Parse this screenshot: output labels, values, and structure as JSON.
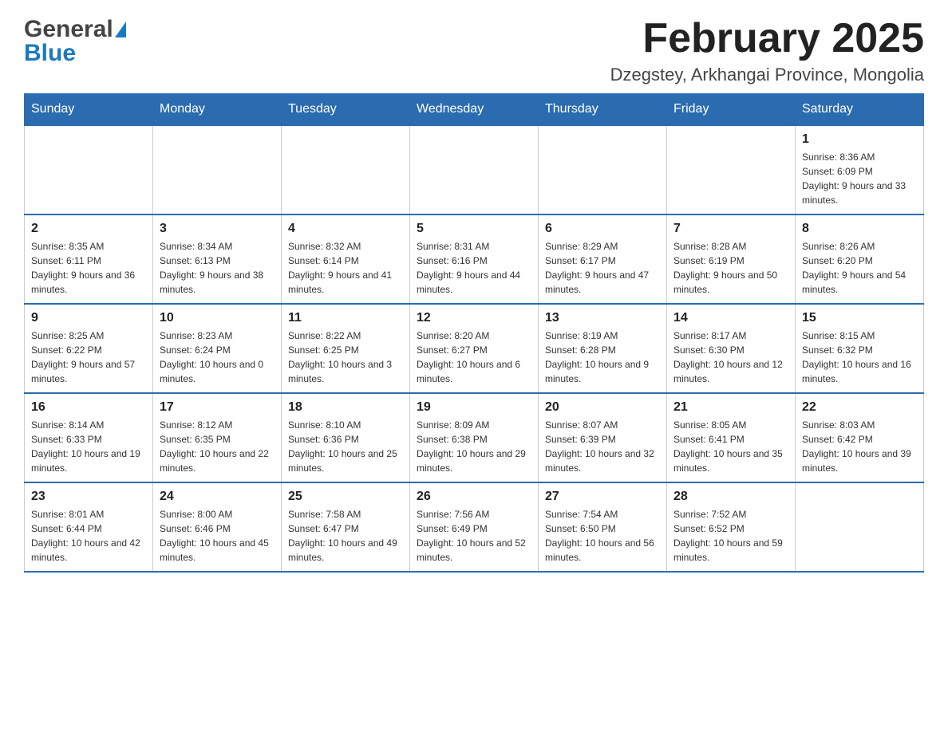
{
  "header": {
    "logo_general": "General",
    "logo_blue": "Blue",
    "month_title": "February 2025",
    "location": "Dzegstey, Arkhangai Province, Mongolia"
  },
  "days_of_week": [
    "Sunday",
    "Monday",
    "Tuesday",
    "Wednesday",
    "Thursday",
    "Friday",
    "Saturday"
  ],
  "weeks": [
    [
      {
        "day": "",
        "info": ""
      },
      {
        "day": "",
        "info": ""
      },
      {
        "day": "",
        "info": ""
      },
      {
        "day": "",
        "info": ""
      },
      {
        "day": "",
        "info": ""
      },
      {
        "day": "",
        "info": ""
      },
      {
        "day": "1",
        "info": "Sunrise: 8:36 AM\nSunset: 6:09 PM\nDaylight: 9 hours and 33 minutes."
      }
    ],
    [
      {
        "day": "2",
        "info": "Sunrise: 8:35 AM\nSunset: 6:11 PM\nDaylight: 9 hours and 36 minutes."
      },
      {
        "day": "3",
        "info": "Sunrise: 8:34 AM\nSunset: 6:13 PM\nDaylight: 9 hours and 38 minutes."
      },
      {
        "day": "4",
        "info": "Sunrise: 8:32 AM\nSunset: 6:14 PM\nDaylight: 9 hours and 41 minutes."
      },
      {
        "day": "5",
        "info": "Sunrise: 8:31 AM\nSunset: 6:16 PM\nDaylight: 9 hours and 44 minutes."
      },
      {
        "day": "6",
        "info": "Sunrise: 8:29 AM\nSunset: 6:17 PM\nDaylight: 9 hours and 47 minutes."
      },
      {
        "day": "7",
        "info": "Sunrise: 8:28 AM\nSunset: 6:19 PM\nDaylight: 9 hours and 50 minutes."
      },
      {
        "day": "8",
        "info": "Sunrise: 8:26 AM\nSunset: 6:20 PM\nDaylight: 9 hours and 54 minutes."
      }
    ],
    [
      {
        "day": "9",
        "info": "Sunrise: 8:25 AM\nSunset: 6:22 PM\nDaylight: 9 hours and 57 minutes."
      },
      {
        "day": "10",
        "info": "Sunrise: 8:23 AM\nSunset: 6:24 PM\nDaylight: 10 hours and 0 minutes."
      },
      {
        "day": "11",
        "info": "Sunrise: 8:22 AM\nSunset: 6:25 PM\nDaylight: 10 hours and 3 minutes."
      },
      {
        "day": "12",
        "info": "Sunrise: 8:20 AM\nSunset: 6:27 PM\nDaylight: 10 hours and 6 minutes."
      },
      {
        "day": "13",
        "info": "Sunrise: 8:19 AM\nSunset: 6:28 PM\nDaylight: 10 hours and 9 minutes."
      },
      {
        "day": "14",
        "info": "Sunrise: 8:17 AM\nSunset: 6:30 PM\nDaylight: 10 hours and 12 minutes."
      },
      {
        "day": "15",
        "info": "Sunrise: 8:15 AM\nSunset: 6:32 PM\nDaylight: 10 hours and 16 minutes."
      }
    ],
    [
      {
        "day": "16",
        "info": "Sunrise: 8:14 AM\nSunset: 6:33 PM\nDaylight: 10 hours and 19 minutes."
      },
      {
        "day": "17",
        "info": "Sunrise: 8:12 AM\nSunset: 6:35 PM\nDaylight: 10 hours and 22 minutes."
      },
      {
        "day": "18",
        "info": "Sunrise: 8:10 AM\nSunset: 6:36 PM\nDaylight: 10 hours and 25 minutes."
      },
      {
        "day": "19",
        "info": "Sunrise: 8:09 AM\nSunset: 6:38 PM\nDaylight: 10 hours and 29 minutes."
      },
      {
        "day": "20",
        "info": "Sunrise: 8:07 AM\nSunset: 6:39 PM\nDaylight: 10 hours and 32 minutes."
      },
      {
        "day": "21",
        "info": "Sunrise: 8:05 AM\nSunset: 6:41 PM\nDaylight: 10 hours and 35 minutes."
      },
      {
        "day": "22",
        "info": "Sunrise: 8:03 AM\nSunset: 6:42 PM\nDaylight: 10 hours and 39 minutes."
      }
    ],
    [
      {
        "day": "23",
        "info": "Sunrise: 8:01 AM\nSunset: 6:44 PM\nDaylight: 10 hours and 42 minutes."
      },
      {
        "day": "24",
        "info": "Sunrise: 8:00 AM\nSunset: 6:46 PM\nDaylight: 10 hours and 45 minutes."
      },
      {
        "day": "25",
        "info": "Sunrise: 7:58 AM\nSunset: 6:47 PM\nDaylight: 10 hours and 49 minutes."
      },
      {
        "day": "26",
        "info": "Sunrise: 7:56 AM\nSunset: 6:49 PM\nDaylight: 10 hours and 52 minutes."
      },
      {
        "day": "27",
        "info": "Sunrise: 7:54 AM\nSunset: 6:50 PM\nDaylight: 10 hours and 56 minutes."
      },
      {
        "day": "28",
        "info": "Sunrise: 7:52 AM\nSunset: 6:52 PM\nDaylight: 10 hours and 59 minutes."
      },
      {
        "day": "",
        "info": ""
      }
    ]
  ]
}
